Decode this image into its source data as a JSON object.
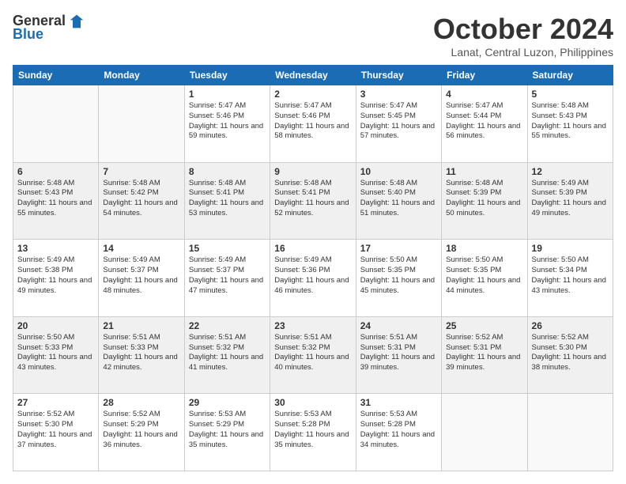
{
  "logo": {
    "general": "General",
    "blue": "Blue"
  },
  "title": "October 2024",
  "location": "Lanat, Central Luzon, Philippines",
  "days_of_week": [
    "Sunday",
    "Monday",
    "Tuesday",
    "Wednesday",
    "Thursday",
    "Friday",
    "Saturday"
  ],
  "weeks": [
    [
      {
        "day": "",
        "info": ""
      },
      {
        "day": "",
        "info": ""
      },
      {
        "day": "1",
        "info": "Sunrise: 5:47 AM\nSunset: 5:46 PM\nDaylight: 11 hours\nand 59 minutes."
      },
      {
        "day": "2",
        "info": "Sunrise: 5:47 AM\nSunset: 5:46 PM\nDaylight: 11 hours\nand 58 minutes."
      },
      {
        "day": "3",
        "info": "Sunrise: 5:47 AM\nSunset: 5:45 PM\nDaylight: 11 hours\nand 57 minutes."
      },
      {
        "day": "4",
        "info": "Sunrise: 5:47 AM\nSunset: 5:44 PM\nDaylight: 11 hours\nand 56 minutes."
      },
      {
        "day": "5",
        "info": "Sunrise: 5:48 AM\nSunset: 5:43 PM\nDaylight: 11 hours\nand 55 minutes."
      }
    ],
    [
      {
        "day": "6",
        "info": "Sunrise: 5:48 AM\nSunset: 5:43 PM\nDaylight: 11 hours\nand 55 minutes."
      },
      {
        "day": "7",
        "info": "Sunrise: 5:48 AM\nSunset: 5:42 PM\nDaylight: 11 hours\nand 54 minutes."
      },
      {
        "day": "8",
        "info": "Sunrise: 5:48 AM\nSunset: 5:41 PM\nDaylight: 11 hours\nand 53 minutes."
      },
      {
        "day": "9",
        "info": "Sunrise: 5:48 AM\nSunset: 5:41 PM\nDaylight: 11 hours\nand 52 minutes."
      },
      {
        "day": "10",
        "info": "Sunrise: 5:48 AM\nSunset: 5:40 PM\nDaylight: 11 hours\nand 51 minutes."
      },
      {
        "day": "11",
        "info": "Sunrise: 5:48 AM\nSunset: 5:39 PM\nDaylight: 11 hours\nand 50 minutes."
      },
      {
        "day": "12",
        "info": "Sunrise: 5:49 AM\nSunset: 5:39 PM\nDaylight: 11 hours\nand 49 minutes."
      }
    ],
    [
      {
        "day": "13",
        "info": "Sunrise: 5:49 AM\nSunset: 5:38 PM\nDaylight: 11 hours\nand 49 minutes."
      },
      {
        "day": "14",
        "info": "Sunrise: 5:49 AM\nSunset: 5:37 PM\nDaylight: 11 hours\nand 48 minutes."
      },
      {
        "day": "15",
        "info": "Sunrise: 5:49 AM\nSunset: 5:37 PM\nDaylight: 11 hours\nand 47 minutes."
      },
      {
        "day": "16",
        "info": "Sunrise: 5:49 AM\nSunset: 5:36 PM\nDaylight: 11 hours\nand 46 minutes."
      },
      {
        "day": "17",
        "info": "Sunrise: 5:50 AM\nSunset: 5:35 PM\nDaylight: 11 hours\nand 45 minutes."
      },
      {
        "day": "18",
        "info": "Sunrise: 5:50 AM\nSunset: 5:35 PM\nDaylight: 11 hours\nand 44 minutes."
      },
      {
        "day": "19",
        "info": "Sunrise: 5:50 AM\nSunset: 5:34 PM\nDaylight: 11 hours\nand 43 minutes."
      }
    ],
    [
      {
        "day": "20",
        "info": "Sunrise: 5:50 AM\nSunset: 5:33 PM\nDaylight: 11 hours\nand 43 minutes."
      },
      {
        "day": "21",
        "info": "Sunrise: 5:51 AM\nSunset: 5:33 PM\nDaylight: 11 hours\nand 42 minutes."
      },
      {
        "day": "22",
        "info": "Sunrise: 5:51 AM\nSunset: 5:32 PM\nDaylight: 11 hours\nand 41 minutes."
      },
      {
        "day": "23",
        "info": "Sunrise: 5:51 AM\nSunset: 5:32 PM\nDaylight: 11 hours\nand 40 minutes."
      },
      {
        "day": "24",
        "info": "Sunrise: 5:51 AM\nSunset: 5:31 PM\nDaylight: 11 hours\nand 39 minutes."
      },
      {
        "day": "25",
        "info": "Sunrise: 5:52 AM\nSunset: 5:31 PM\nDaylight: 11 hours\nand 39 minutes."
      },
      {
        "day": "26",
        "info": "Sunrise: 5:52 AM\nSunset: 5:30 PM\nDaylight: 11 hours\nand 38 minutes."
      }
    ],
    [
      {
        "day": "27",
        "info": "Sunrise: 5:52 AM\nSunset: 5:30 PM\nDaylight: 11 hours\nand 37 minutes."
      },
      {
        "day": "28",
        "info": "Sunrise: 5:52 AM\nSunset: 5:29 PM\nDaylight: 11 hours\nand 36 minutes."
      },
      {
        "day": "29",
        "info": "Sunrise: 5:53 AM\nSunset: 5:29 PM\nDaylight: 11 hours\nand 35 minutes."
      },
      {
        "day": "30",
        "info": "Sunrise: 5:53 AM\nSunset: 5:28 PM\nDaylight: 11 hours\nand 35 minutes."
      },
      {
        "day": "31",
        "info": "Sunrise: 5:53 AM\nSunset: 5:28 PM\nDaylight: 11 hours\nand 34 minutes."
      },
      {
        "day": "",
        "info": ""
      },
      {
        "day": "",
        "info": ""
      }
    ]
  ]
}
